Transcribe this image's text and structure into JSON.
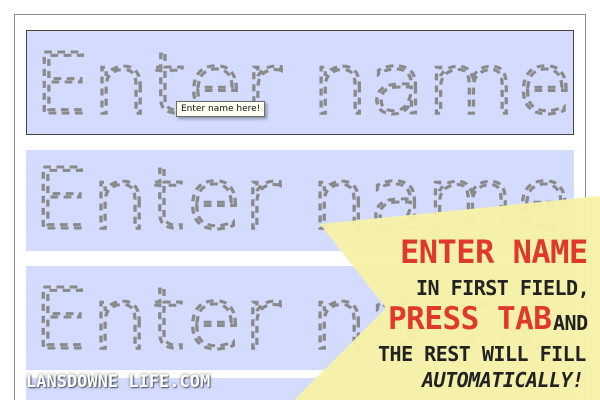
{
  "form": {
    "fields": [
      {
        "placeholder": "Enter name"
      },
      {
        "placeholder": "Enter name"
      },
      {
        "placeholder": "Enter name"
      }
    ],
    "tooltip": "Enter name here!"
  },
  "callout": {
    "line1": "ENTER NAME",
    "line2": "IN FIRST FIELD,",
    "line3_red": "PRESS TAB",
    "line3_dark": "AND",
    "line4": "THE REST WILL FILL",
    "line5": "AUTOMATICALLY!"
  },
  "watermark": "LANSDOWNE LIFE.COM",
  "colors": {
    "field_background": "#d3dcff",
    "callout_yellow": "#f6f2a8",
    "accent_red": "#e0382b"
  }
}
